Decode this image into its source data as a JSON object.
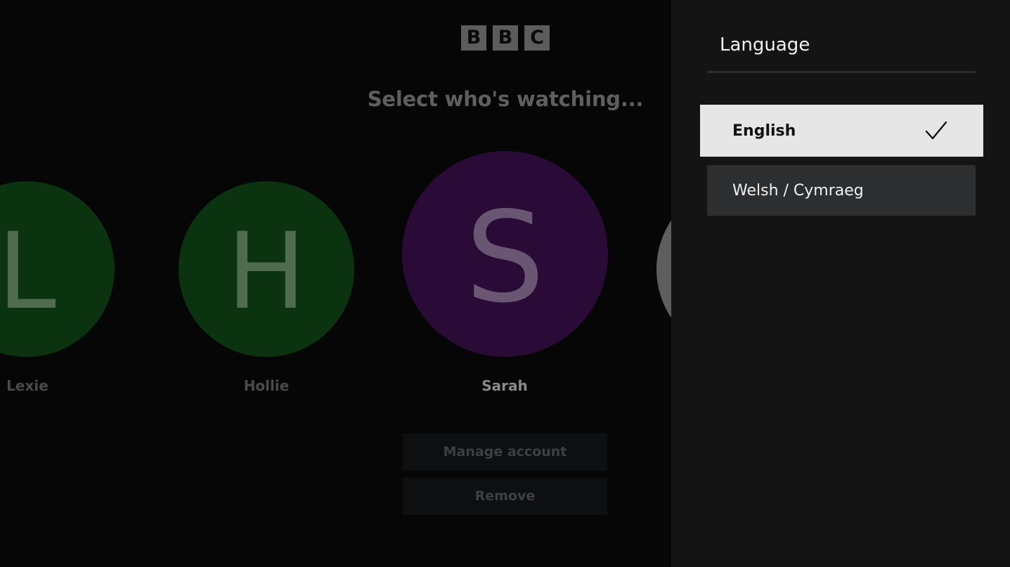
{
  "logo": {
    "letters": [
      "B",
      "B",
      "C"
    ]
  },
  "heading": "Select who's watching...",
  "profiles": [
    {
      "initial": "L",
      "name": "Lexie",
      "color": "#0b330f"
    },
    {
      "initial": "H",
      "name": "Hollie",
      "color": "#0b330f"
    },
    {
      "initial": "S",
      "name": "Sarah",
      "color": "#2a0a37"
    },
    {
      "initial": "",
      "name": "",
      "color": "#5e5e5e"
    }
  ],
  "actions": {
    "manage": "Manage account",
    "remove": "Remove"
  },
  "language_panel": {
    "title": "Language",
    "options": [
      {
        "label": "English",
        "selected": true,
        "icon": "checkmark-icon"
      },
      {
        "label": "Welsh / Cymraeg",
        "selected": false
      }
    ]
  },
  "colors": {
    "panel_bg": "#141414",
    "selected_option_bg": "#e6e6e6",
    "option_bg": "#2d2e30"
  }
}
